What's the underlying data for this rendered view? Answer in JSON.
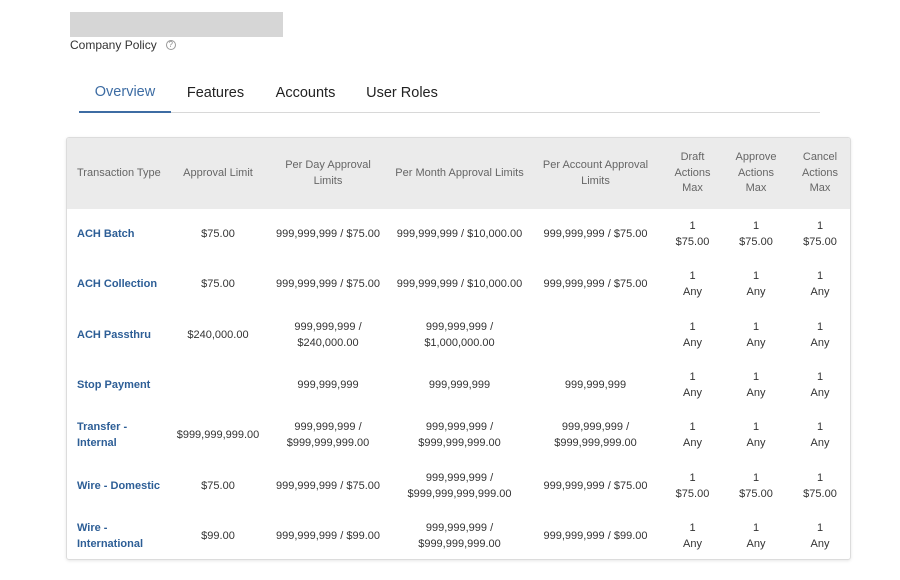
{
  "header": {
    "subtitle": "Company Policy",
    "help_icon": "?"
  },
  "tabs": [
    {
      "label": "Overview",
      "active": true
    },
    {
      "label": "Features",
      "active": false
    },
    {
      "label": "Accounts",
      "active": false
    },
    {
      "label": "User Roles",
      "active": false
    }
  ],
  "table": {
    "columns": [
      "Transaction Type",
      "Approval Limit",
      "Per Day Approval Limits",
      "Per Month Approval Limits",
      "Per Account Approval Limits",
      "Draft Actions Max",
      "Approve Actions Max",
      "Cancel Actions Max"
    ],
    "rows": [
      {
        "type": "ACH Batch",
        "approval_limit": "$75.00",
        "per_day": "999,999,999 / $75.00",
        "per_month": "999,999,999 / $10,000.00",
        "per_account": "999,999,999 / $75.00",
        "draft": [
          "1",
          "$75.00"
        ],
        "approve": [
          "1",
          "$75.00"
        ],
        "cancel": [
          "1",
          "$75.00"
        ]
      },
      {
        "type": "ACH Collection",
        "approval_limit": "$75.00",
        "per_day": "999,999,999 / $75.00",
        "per_month": "999,999,999 / $10,000.00",
        "per_account": "999,999,999 / $75.00",
        "draft": [
          "1",
          "Any"
        ],
        "approve": [
          "1",
          "Any"
        ],
        "cancel": [
          "1",
          "Any"
        ]
      },
      {
        "type": "ACH Passthru",
        "approval_limit": "$240,000.00",
        "per_day": "999,999,999 / $240,000.00",
        "per_month": "999,999,999 / $1,000,000.00",
        "per_account": "",
        "draft": [
          "1",
          "Any"
        ],
        "approve": [
          "1",
          "Any"
        ],
        "cancel": [
          "1",
          "Any"
        ]
      },
      {
        "type": "Stop Payment",
        "approval_limit": "",
        "per_day": "999,999,999",
        "per_month": "999,999,999",
        "per_account": "999,999,999",
        "draft": [
          "1",
          "Any"
        ],
        "approve": [
          "1",
          "Any"
        ],
        "cancel": [
          "1",
          "Any"
        ]
      },
      {
        "type": "Transfer - Internal",
        "approval_limit": "$999,999,999.00",
        "per_day": "999,999,999 / $999,999,999.00",
        "per_month": "999,999,999 / $999,999,999.00",
        "per_account": "999,999,999 / $999,999,999.00",
        "draft": [
          "1",
          "Any"
        ],
        "approve": [
          "1",
          "Any"
        ],
        "cancel": [
          "1",
          "Any"
        ]
      },
      {
        "type": "Wire - Domestic",
        "approval_limit": "$75.00",
        "per_day": "999,999,999 / $75.00",
        "per_month": "999,999,999 / $999,999,999,999.00",
        "per_account": "999,999,999 / $75.00",
        "draft": [
          "1",
          "$75.00"
        ],
        "approve": [
          "1",
          "$75.00"
        ],
        "cancel": [
          "1",
          "$75.00"
        ]
      },
      {
        "type": "Wire - International",
        "approval_limit": "$99.00",
        "per_day": "999,999,999 / $99.00",
        "per_month": "999,999,999 / $999,999,999.00",
        "per_account": "999,999,999 / $99.00",
        "draft": [
          "1",
          "Any"
        ],
        "approve": [
          "1",
          "Any"
        ],
        "cancel": [
          "1",
          "Any"
        ]
      }
    ]
  }
}
